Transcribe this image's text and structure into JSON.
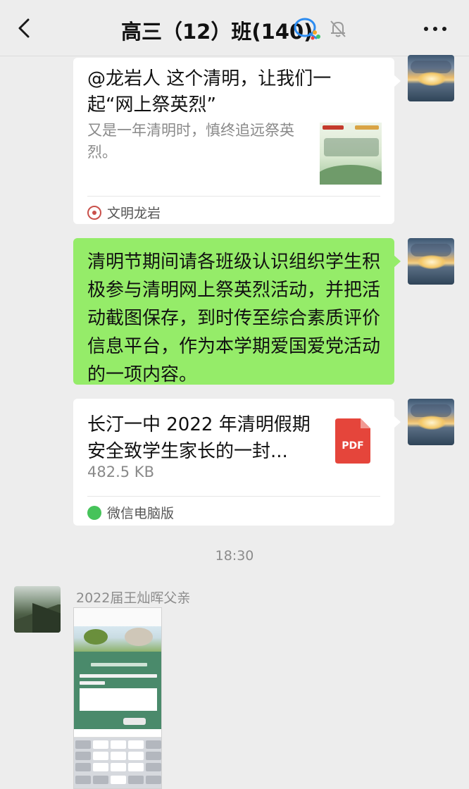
{
  "header": {
    "title": "高三（12）班(140)"
  },
  "messages": {
    "link_card": {
      "title": "@龙岩人 这个清明，让我们一起“网上祭英烈”",
      "description": "又是一年清明时，慎终追远祭英烈。",
      "source": "文明龙岩"
    },
    "notice": {
      "text": "清明节期间请各班级认识组织学生积极参与清明网上祭英烈活动，并把活动截图保存，到时传至综合素质评价信息平台，作为本学期爱国爱党活动的一项内容。"
    },
    "file_card": {
      "title": "长汀一中 2022 年清明假期安全致学生家长的一封...",
      "size": "482.5 KB",
      "file_type": "PDF",
      "source": "微信电脑版"
    },
    "timestamp": "18:30",
    "incoming": {
      "sender": "2022届王灿晖父亲"
    }
  },
  "icons": {
    "back": "chevron-left-icon",
    "group_badge": "enterprise-chat-icon",
    "mute": "bell-muted-icon",
    "more": "more-dots-icon",
    "file": "pdf-file-icon"
  },
  "colors": {
    "background": "#ededed",
    "green_bubble": "#95ec69",
    "white_bubble": "#ffffff",
    "pdf_red": "#e5453b"
  }
}
